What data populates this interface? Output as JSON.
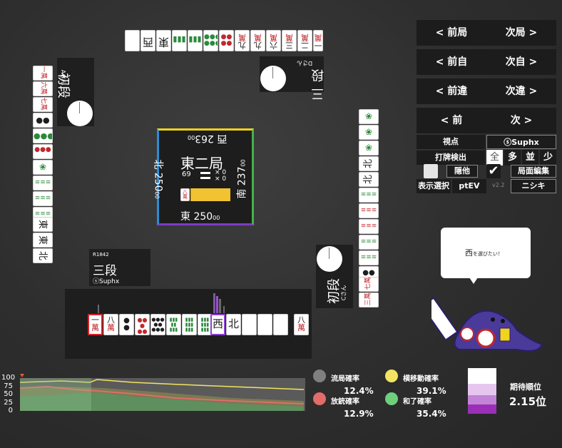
{
  "nav": {
    "prev_round": "< 前局",
    "next_round": "次局 >",
    "prev_self": "< 前自",
    "next_self": "次自 >",
    "prev_mistake": "< 前違",
    "next_mistake": "次違 >",
    "prev": "< 前",
    "next": "次 >"
  },
  "settings": {
    "viewpoint_label": "視点",
    "viewpoint_value": "ⓢSuphx",
    "discard_detect_label": "打牌検出",
    "detect_options": [
      "全",
      "多",
      "並",
      "少"
    ],
    "detect_selected": "全",
    "hide_label": "隠他",
    "hide_checked": false,
    "edit_label": "局面編集",
    "edit_checked": true,
    "display_select_label": "表示選択",
    "display_select_value": "ptEV",
    "version": "v2.2",
    "model_value": "ニシキ"
  },
  "center": {
    "round": "東二局",
    "honba_count": "69",
    "riichi_stick_counter": "× 0",
    "honba_stick_counter": "× 0",
    "wall_tile": "八萬",
    "east_score": "東 250",
    "east_sub": "00",
    "south_score": "南 237",
    "south_sub": "00",
    "west_score": "西 263",
    "west_sub": "00",
    "north_score": "北 250",
    "north_sub": "00"
  },
  "players": {
    "self": {
      "rating": "R1842",
      "rank": "三段",
      "name": "ⓢSuphx"
    },
    "left": {
      "rank": "初段",
      "name": "Aさん"
    },
    "top": {
      "rank": "三段",
      "name": "Dさん"
    },
    "right": {
      "rank": "初段",
      "name": "Cさん"
    }
  },
  "hand": {
    "tiles": [
      "一萬",
      "八萬",
      "2筒",
      "5筒",
      "8筒",
      "8索",
      "9索",
      "西",
      "北",
      "",
      "",
      "",
      ""
    ],
    "drawn": "八萬"
  },
  "bubble": {
    "tile": "西",
    "text": "を選びたい！"
  },
  "legend": {
    "draw_label": "流局確率",
    "draw_value": "12.4%",
    "move_label": "横移動確率",
    "move_value": "39.1%",
    "dealin_label": "放銃確率",
    "dealin_value": "12.9%",
    "win_label": "和了確率",
    "win_value": "35.4%",
    "expected_label": "期待順位",
    "expected_value": "2.15位"
  },
  "graph": {
    "y_ticks": [
      "100",
      "75",
      "50",
      "25",
      "0"
    ]
  },
  "colors": {
    "draw": "#808080",
    "move": "#f2e463",
    "dealin": "#e36b6b",
    "win": "#6fcf7d",
    "rank_light": "#e6c6ee",
    "rank_mid": "#c284d6",
    "rank_dark": "#9b2fb8"
  }
}
